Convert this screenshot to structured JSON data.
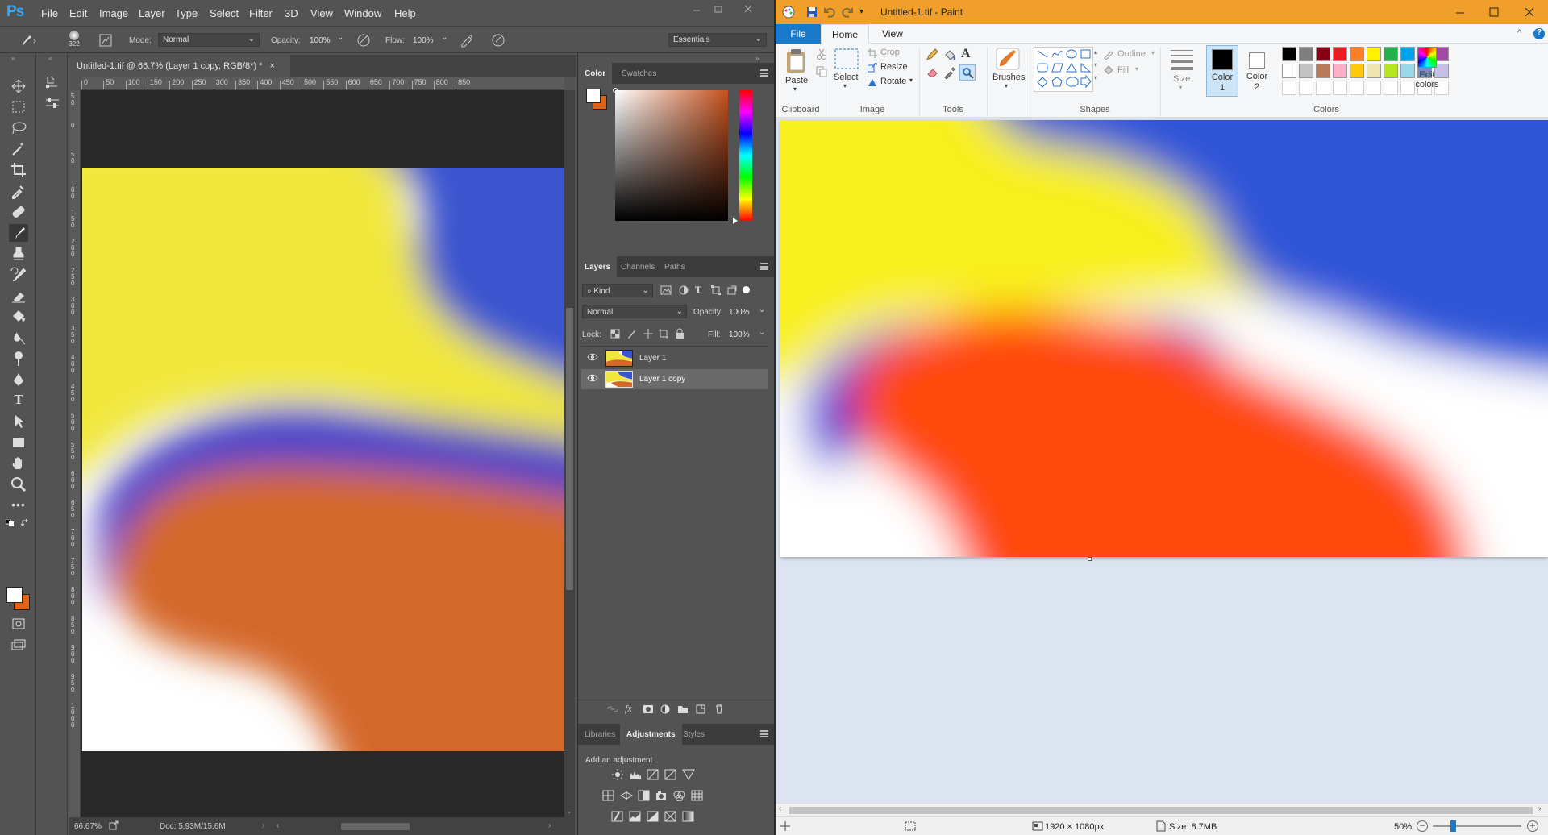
{
  "photoshop": {
    "logo": "Ps",
    "menu": [
      "File",
      "Edit",
      "Image",
      "Layer",
      "Type",
      "Select",
      "Filter",
      "3D",
      "View",
      "Window",
      "Help"
    ],
    "options": {
      "brush_size": "322",
      "mode_label": "Mode:",
      "mode_value": "Normal",
      "opacity_label": "Opacity:",
      "opacity_value": "100%",
      "flow_label": "Flow:",
      "flow_value": "100%",
      "workspace": "Essentials"
    },
    "document_tab": "Untitled-1.tif @ 66.7% (Layer 1 copy, RGB/8*) *",
    "ruler_h_ticks": [
      "0",
      "50",
      "100",
      "150",
      "200",
      "250",
      "300",
      "350",
      "400",
      "450",
      "500",
      "550",
      "600",
      "650",
      "700",
      "750",
      "800",
      "850"
    ],
    "ruler_v_ticks": [
      "50",
      "0",
      "50",
      "100",
      "150",
      "200",
      "250",
      "300",
      "350",
      "400",
      "450",
      "500",
      "550",
      "600",
      "650",
      "700",
      "750",
      "800",
      "850",
      "900",
      "950",
      "1000"
    ],
    "status": {
      "zoom": "66.67%",
      "doc": "Doc: 5.93M/15.6M"
    },
    "color_panel": {
      "tabs": [
        "Color",
        "Swatches"
      ],
      "foreground": "#ffffff",
      "background": "#e0631a"
    },
    "layers_panel": {
      "tabs": [
        "Layers",
        "Channels",
        "Paths"
      ],
      "kind": "Kind",
      "blend_mode": "Normal",
      "opacity_label": "Opacity:",
      "opacity_value": "100%",
      "lock_label": "Lock:",
      "fill_label": "Fill:",
      "fill_value": "100%",
      "layers": [
        {
          "name": "Layer 1",
          "selected": false
        },
        {
          "name": "Layer 1 copy",
          "selected": true
        }
      ]
    },
    "adjustments_panel": {
      "tabs": [
        "Libraries",
        "Adjustments",
        "Styles"
      ],
      "heading": "Add an adjustment"
    }
  },
  "paint": {
    "title": "Untitled-1.tif - Paint",
    "tabs": [
      "File",
      "Home",
      "View"
    ],
    "clipboard": {
      "paste": "Paste",
      "group": "Clipboard"
    },
    "image": {
      "select": "Select",
      "crop": "Crop",
      "resize": "Resize",
      "rotate": "Rotate",
      "group": "Image"
    },
    "tools": {
      "group": "Tools"
    },
    "brushes": "Brushes",
    "shapes": {
      "outline": "Outline",
      "fill": "Fill",
      "group": "Shapes"
    },
    "size": "Size",
    "color1": [
      "Color",
      "1"
    ],
    "color2": [
      "Color",
      "2"
    ],
    "edit_colors": [
      "Edit",
      "colors"
    ],
    "colors_group": "Colors",
    "palette_row1": [
      "#000000",
      "#7f7f7f",
      "#880015",
      "#ed1c24",
      "#ff7f27",
      "#fff200",
      "#22b14c",
      "#00a2e8",
      "#3f48cc",
      "#a349a4"
    ],
    "palette_row2": [
      "#ffffff",
      "#c3c3c3",
      "#b97a57",
      "#ffaec9",
      "#ffc90e",
      "#efe4b0",
      "#b5e61d",
      "#99d9ea",
      "#7092be",
      "#c8bfe7"
    ],
    "status": {
      "dimensions": "1920 × 1080px",
      "size": "Size: 8.7MB",
      "zoom": "50%"
    }
  }
}
